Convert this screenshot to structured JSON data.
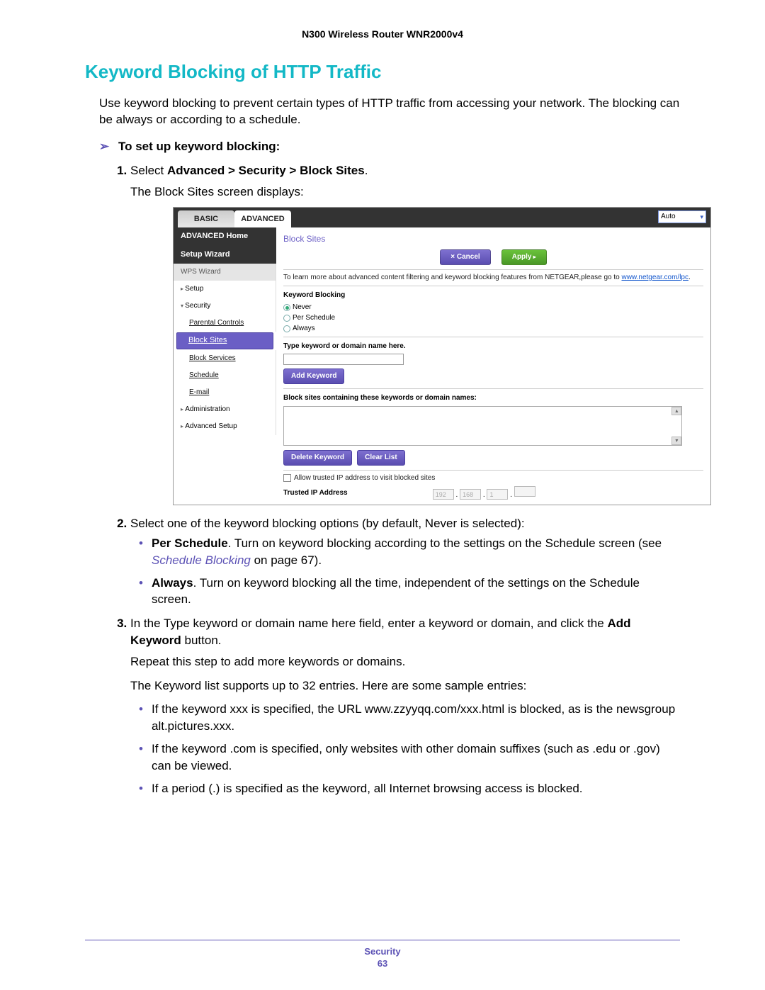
{
  "doc_header": "N300 Wireless Router WNR2000v4",
  "section_title": "Keyword Blocking of HTTP Traffic",
  "intro": "Use keyword blocking to prevent certain types of HTTP traffic from accessing your network. The blocking can be always or according to a schedule.",
  "task_arrow": "➢",
  "task_heading": "To set up keyword blocking:",
  "steps": {
    "s1_prefix": "Select ",
    "s1_bold": "Advanced > Security > Block Sites",
    "s1_suffix": ".",
    "s1_sub": "The Block Sites screen displays:",
    "s2": "Select one of the keyword blocking options (by default, Never is selected):",
    "s2_opts": {
      "a_bold": "Per Schedule",
      "a_text": ". Turn on keyword blocking according to the settings on the Schedule screen (see ",
      "a_link": "Schedule Blocking",
      "a_text2": " on page 67).",
      "b_bold": "Always",
      "b_text": ". Turn on keyword blocking all the time, independent of the settings on the Schedule screen."
    },
    "s3_a": "In the Type keyword or domain name here field, enter a keyword or domain, and click the ",
    "s3_b": "Add Keyword",
    "s3_c": " button.",
    "s3_sub1": "Repeat this step to add more keywords or domains.",
    "s3_sub2": "The Keyword list supports up to 32 entries. Here are some sample entries:",
    "s3_bullets": {
      "b1": "If the keyword xxx is specified, the URL www.zzyyqq.com/xxx.html is blocked, as is the newsgroup alt.pictures.xxx.",
      "b2": "If the keyword .com is specified, only websites with other domain suffixes (such as .edu or .gov) can be viewed.",
      "b3": "If a period (.) is specified as the keyword, all Internet browsing access is blocked."
    }
  },
  "footer": {
    "chapter": "Security",
    "page": "63"
  },
  "ui": {
    "tabs": {
      "basic": "BASIC",
      "advanced": "ADVANCED"
    },
    "lang": "Auto",
    "sidebar": {
      "home": "ADVANCED Home",
      "wizard": "Setup Wizard",
      "wps": "WPS Wizard",
      "setup": "Setup",
      "security": "Security",
      "sub_parental": "Parental Controls",
      "sub_block_sites": "Block Sites",
      "sub_block_services": "Block Services",
      "sub_schedule": "Schedule",
      "sub_email": "E-mail",
      "admin": "Administration",
      "advsetup": "Advanced Setup"
    },
    "panel": {
      "title": "Block Sites",
      "cancel": "Cancel",
      "apply": "Apply",
      "learn_more": "To learn more about advanced content filtering and keyword blocking features from NETGEAR,please go to ",
      "learn_more_link": "www.netgear.com/lpc",
      "kb_heading": "Keyword Blocking",
      "opt_never": "Never",
      "opt_per": "Per Schedule",
      "opt_always": "Always",
      "type_heading": "Type keyword or domain name here.",
      "add_keyword": "Add Keyword",
      "list_heading": "Block sites containing these keywords or domain names:",
      "delete_keyword": "Delete Keyword",
      "clear_list": "Clear List",
      "allow_trusted": "Allow trusted IP address to visit blocked sites",
      "trusted_label": "Trusted IP Address",
      "ip": {
        "a": "192",
        "b": "168",
        "c": "1",
        "d": ""
      }
    }
  }
}
